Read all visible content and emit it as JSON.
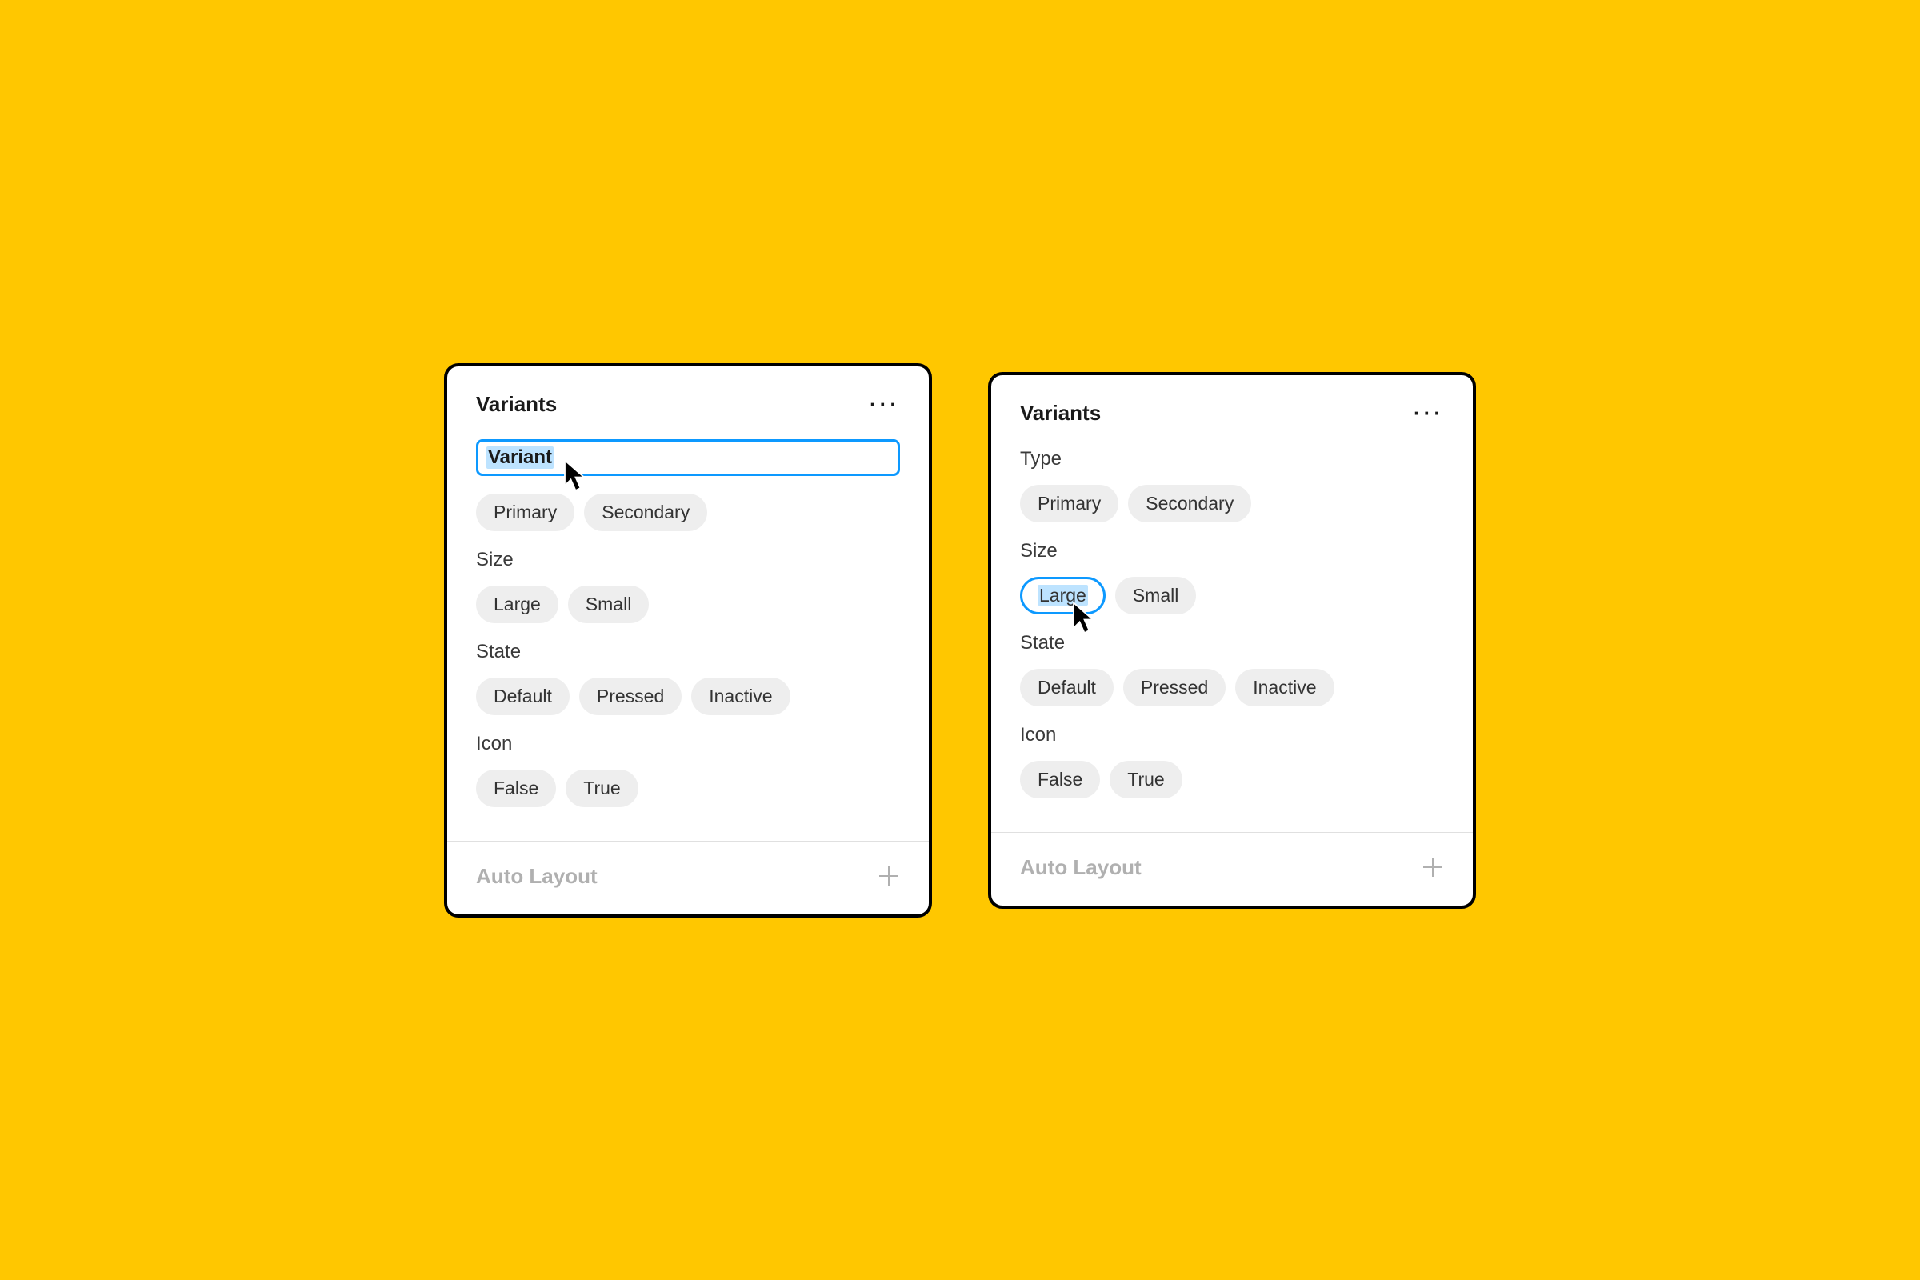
{
  "colors": {
    "background": "#ffc700",
    "panel_border": "#000000",
    "selection_blue": "#0d99ff",
    "selection_fill": "#bde3ff",
    "chip_bg": "#eeeeee",
    "muted": "#b0b0b0"
  },
  "panel_left": {
    "header": {
      "title": "Variants",
      "more_icon": "more-icon"
    },
    "editing_property": {
      "value": "Variant"
    },
    "properties": [
      {
        "label": null,
        "editing": true,
        "values": [
          "Primary",
          "Secondary"
        ]
      },
      {
        "label": "Size",
        "values": [
          "Large",
          "Small"
        ]
      },
      {
        "label": "State",
        "values": [
          "Default",
          "Pressed",
          "Inactive"
        ]
      },
      {
        "label": "Icon",
        "values": [
          "False",
          "True"
        ]
      }
    ],
    "footer": {
      "label": "Auto Layout",
      "add_icon": "plus-icon"
    }
  },
  "panel_right": {
    "header": {
      "title": "Variants",
      "more_icon": "more-icon"
    },
    "properties": [
      {
        "label": "Type",
        "values": [
          "Primary",
          "Secondary"
        ]
      },
      {
        "label": "Size",
        "values": [
          "Large",
          "Small"
        ],
        "editing_value_index": 0
      },
      {
        "label": "State",
        "values": [
          "Default",
          "Pressed",
          "Inactive"
        ]
      },
      {
        "label": "Icon",
        "values": [
          "False",
          "True"
        ]
      }
    ],
    "footer": {
      "label": "Auto Layout",
      "add_icon": "plus-icon"
    }
  }
}
